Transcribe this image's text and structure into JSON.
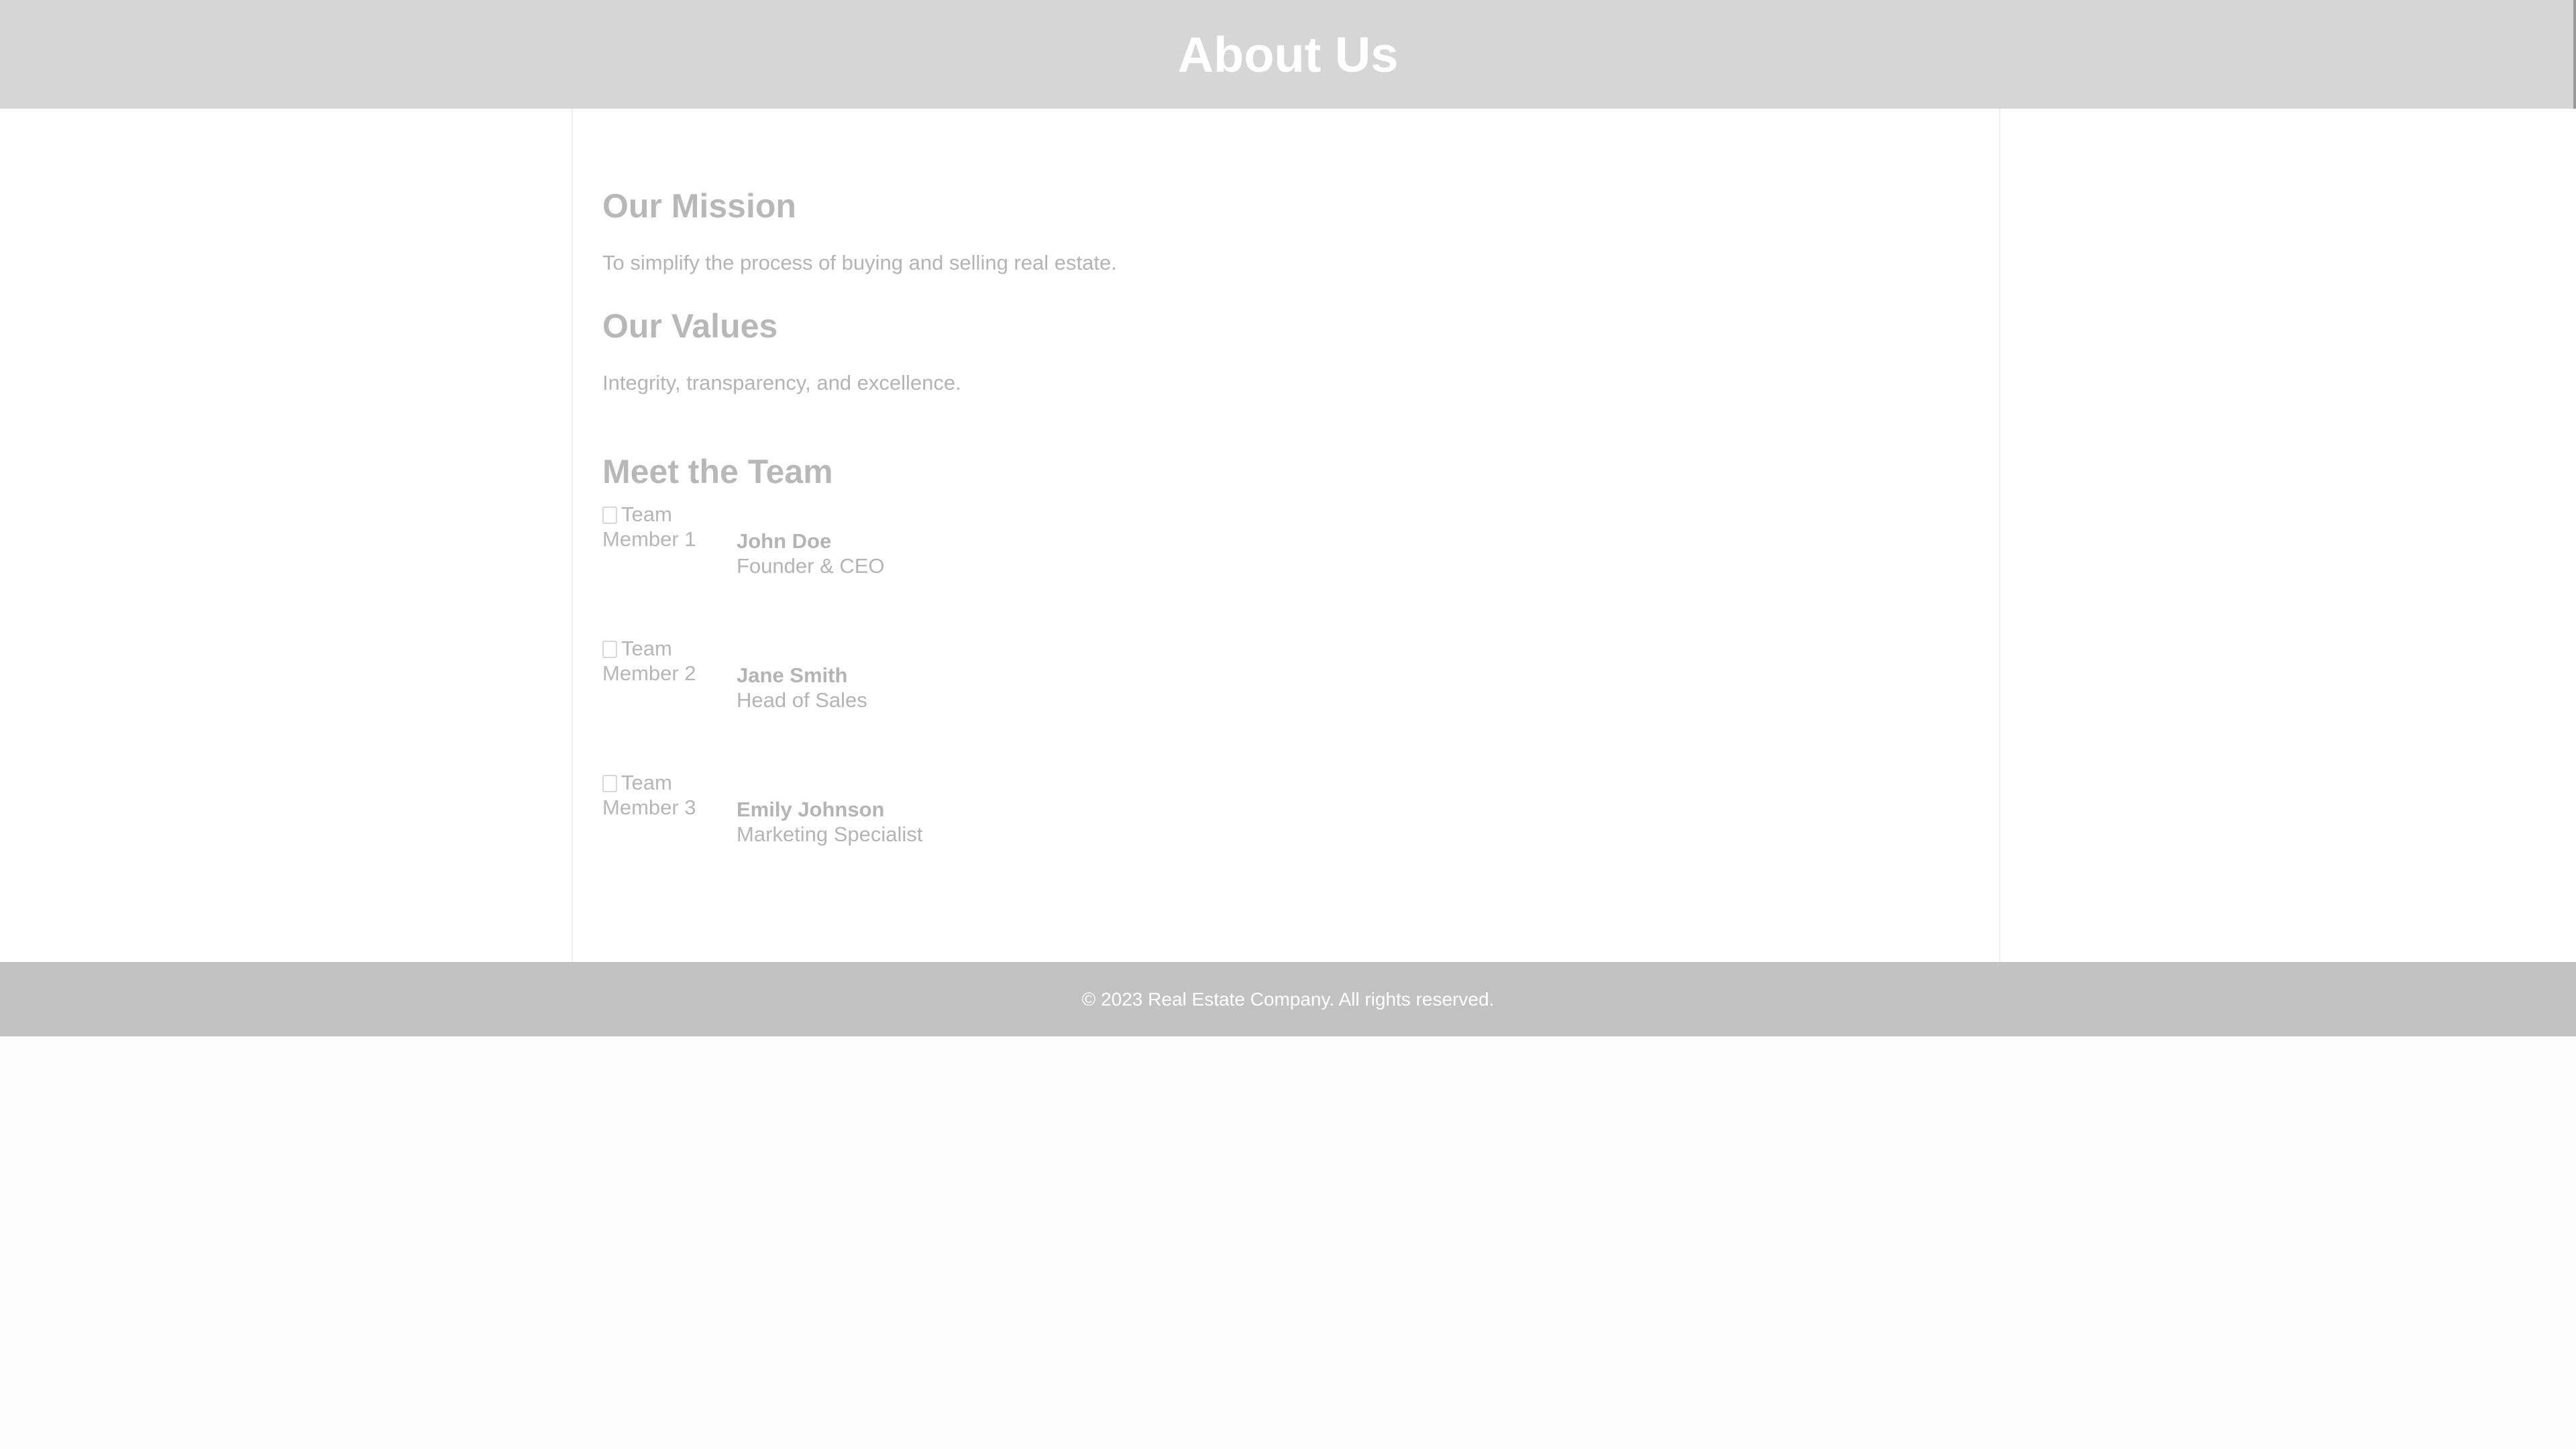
{
  "header": {
    "title": "About Us"
  },
  "mission": {
    "heading": "Our Mission",
    "text": "To simplify the process of buying and selling real estate."
  },
  "values": {
    "heading": "Our Values",
    "text": "Integrity, transparency, and excellence."
  },
  "team": {
    "heading": "Meet the Team",
    "members": [
      {
        "photo_alt": "Team Member 1",
        "photo_alt_line1": "Team",
        "photo_alt_line2": "Member 1",
        "name": "John Doe",
        "role": "Founder & CEO"
      },
      {
        "photo_alt": "Team Member 2",
        "photo_alt_line1": "Team",
        "photo_alt_line2": "Member 2",
        "name": "Jane Smith",
        "role": "Head of Sales"
      },
      {
        "photo_alt": "Team Member 3",
        "photo_alt_line1": "Team",
        "photo_alt_line2": "Member 3",
        "name": "Emily Johnson",
        "role": "Marketing Specialist"
      }
    ]
  },
  "footer": {
    "copyright": "© 2023 Real Estate Company. All rights reserved."
  },
  "icons": {
    "broken_image": "broken-image-icon"
  },
  "colors": {
    "header_bg": "#d6d6d6",
    "footer_bg": "#c2c2c2",
    "text_muted": "#b4b4b4"
  }
}
